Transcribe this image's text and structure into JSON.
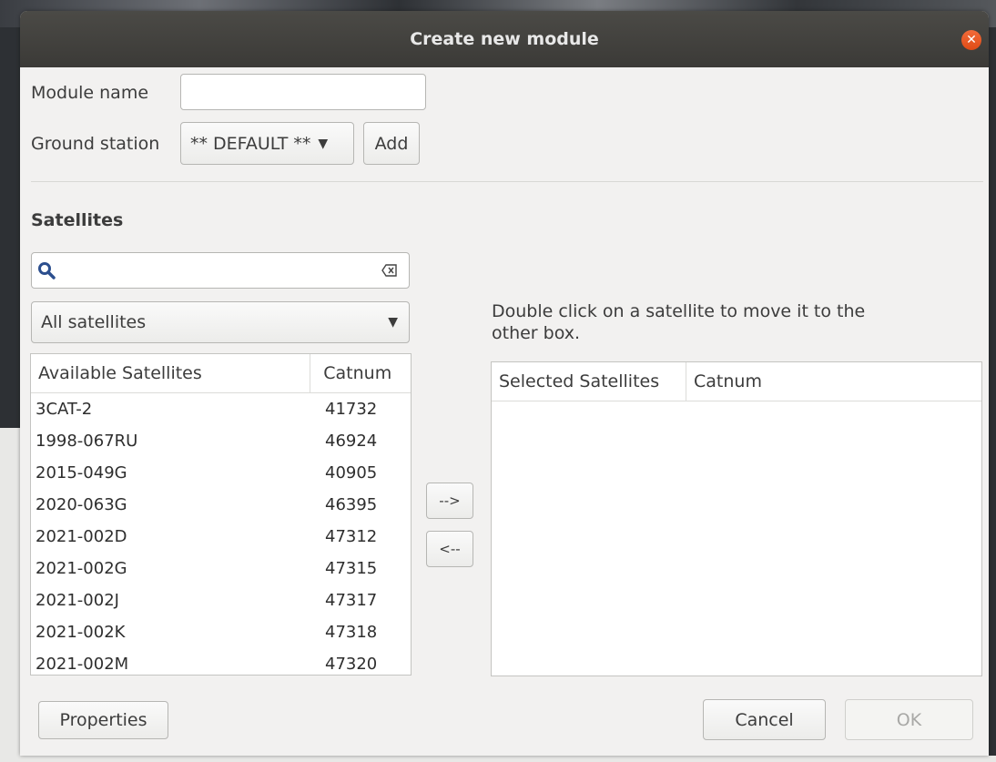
{
  "dialog": {
    "title": "Create new module"
  },
  "form": {
    "module_name_label": "Module name",
    "module_name_value": "",
    "ground_station_label": "Ground station",
    "ground_station_value": "** DEFAULT **",
    "add_label": "Add"
  },
  "satellites": {
    "section_title": "Satellites",
    "search_value": "",
    "filter_value": "All satellites",
    "hint": "Double click on a satellite to move it to the other box.",
    "available": {
      "headers": [
        "Available Satellites",
        "Catnum"
      ],
      "rows": [
        [
          "3CAT-2",
          "41732"
        ],
        [
          "1998-067RU",
          "46924"
        ],
        [
          "2015-049G",
          "40905"
        ],
        [
          "2020-063G",
          "46395"
        ],
        [
          "2021-002D",
          "47312"
        ],
        [
          "2021-002G",
          "47315"
        ],
        [
          "2021-002J",
          "47317"
        ],
        [
          "2021-002K",
          "47318"
        ],
        [
          "2021-002M",
          "47320"
        ]
      ]
    },
    "selected": {
      "headers": [
        "Selected Satellites",
        "Catnum"
      ],
      "rows": []
    },
    "move_right_label": "-->",
    "move_left_label": "<--"
  },
  "footer": {
    "properties_label": "Properties",
    "cancel_label": "Cancel",
    "ok_label": "OK"
  },
  "colors": {
    "titlebar": "#3d3c38",
    "close": "#e5551f",
    "dialog_bg": "#f2f1f0"
  }
}
